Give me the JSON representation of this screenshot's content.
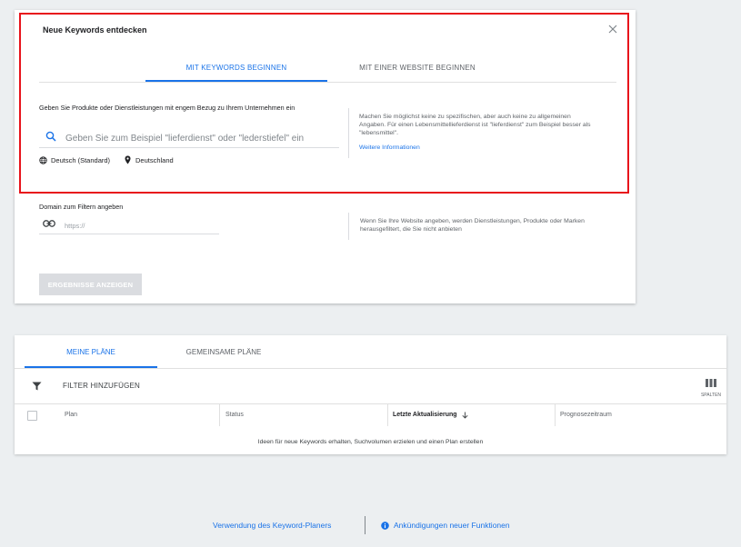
{
  "dialog": {
    "title": "Neue Keywords entdecken",
    "tabs": [
      "MIT KEYWORDS BEGINNEN",
      "MIT EINER WEBSITE BEGINNEN"
    ],
    "products_label": "Geben Sie Produkte oder Dienstleistungen mit engem Bezug zu Ihrem Unternehmen ein",
    "search_placeholder": "Geben Sie zum Beispiel \"lieferdienst\" oder \"lederstiefel\" ein",
    "language": "Deutsch (Standard)",
    "location": "Deutschland",
    "hint_text": "Machen Sie möglichst keine zu spezifischen, aber auch keine zu allgemeinen Angaben. Für einen Lebensmittellieferdienst ist \"lieferdienst\" zum Beispiel besser als \"lebensmittel\".",
    "more_info_link": "Weitere Informationen",
    "domain_label": "Domain zum Filtern angeben",
    "domain_placeholder": "https://",
    "domain_hint": "Wenn Sie Ihre Website angeben, werden Dienstleistungen, Produkte oder Marken herausgefiltert, die Sie nicht anbieten",
    "results_button": "ERGEBNISSE ANZEIGEN"
  },
  "plans": {
    "tabs": [
      "MEINE PLÄNE",
      "GEMEINSAME PLÄNE"
    ],
    "filter_label": "FILTER HINZUFÜGEN",
    "columns_label": "SPALTEN",
    "columns": [
      "Plan",
      "Status",
      "Letzte Aktualisierung",
      "Prognosezeitraum"
    ],
    "empty_message": "Ideen für neue Keywords erhalten, Suchvolumen erzielen und einen Plan erstellen"
  },
  "footer": {
    "usage_link": "Verwendung des Keyword-Planers",
    "announcements_link": "Ankündigungen neuer Funktionen"
  },
  "colors": {
    "accent": "#1a73e8",
    "highlight_border": "#e8131b",
    "disabled_button": "#dadce0"
  }
}
